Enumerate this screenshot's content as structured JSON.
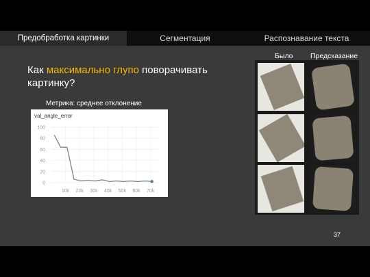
{
  "nav": {
    "tabs": [
      {
        "label": "Предобработка картинки",
        "active": true
      },
      {
        "label": "Сегментация",
        "active": false
      },
      {
        "label": "Распознавание текста",
        "active": false
      }
    ]
  },
  "slide": {
    "title_plain_1": "Как ",
    "title_accent": "максимально глупо",
    "title_plain_2": " поворачивать картинку?",
    "metric_label": "Метрика: среднее отклонение",
    "col_before": "Было",
    "col_predicted": "Предсказание",
    "page_number": "37"
  },
  "colors": {
    "accent": "#f5b700",
    "line": "#7a8a7a",
    "nav_active": "#2b2b2b",
    "nav_inactive": "#0f0f0f"
  },
  "chart_data": {
    "type": "line",
    "title": "val_angle_error",
    "x_tick_labels": [
      "10k",
      "20k",
      "30k",
      "40k",
      "50k",
      "60k",
      "70k"
    ],
    "y_tick_labels": [
      "0",
      "20",
      "40",
      "60",
      "80",
      "100"
    ],
    "xlim": [
      0,
      75000
    ],
    "ylim": [
      0,
      105
    ],
    "grid": true,
    "series": [
      {
        "x": [
          2000,
          6500,
          11000,
          16000,
          21000,
          26000,
          31000,
          36000,
          41000,
          46000,
          51000,
          56000,
          61000,
          66000,
          71000
        ],
        "y": [
          86,
          64,
          64,
          6,
          3,
          4,
          3,
          5,
          2,
          3,
          2,
          3,
          2,
          3,
          2
        ]
      }
    ]
  }
}
